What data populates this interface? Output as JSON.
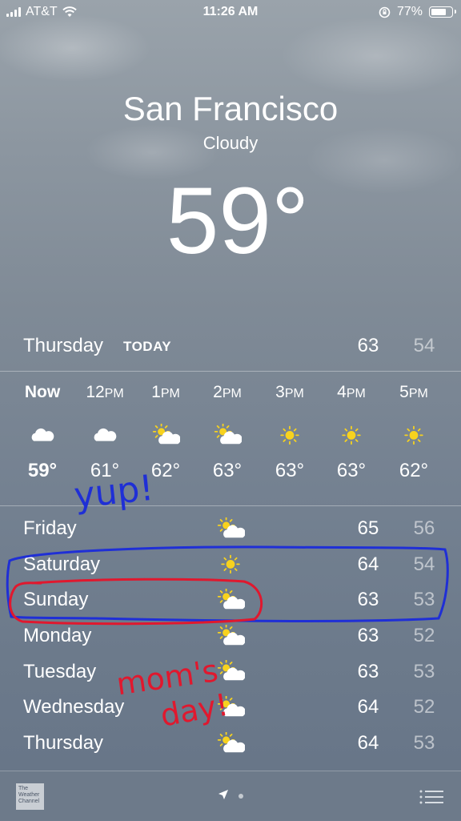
{
  "status_bar": {
    "carrier": "AT&T",
    "time": "11:26 AM",
    "battery": "77%",
    "battery_level": 0.77
  },
  "location": {
    "city": "San Francisco",
    "condition": "Cloudy",
    "temperature": "59°"
  },
  "today": {
    "day": "Thursday",
    "tag": "TODAY",
    "high": "63",
    "low": "54"
  },
  "hourly": [
    {
      "label": "Now",
      "suffix": "",
      "icon": "cloud-icon",
      "temp": "59°"
    },
    {
      "label": "12",
      "suffix": "PM",
      "icon": "cloud-icon",
      "temp": "61°"
    },
    {
      "label": "1",
      "suffix": "PM",
      "icon": "partly-sunny-icon",
      "temp": "62°"
    },
    {
      "label": "2",
      "suffix": "PM",
      "icon": "partly-sunny-icon",
      "temp": "63°"
    },
    {
      "label": "3",
      "suffix": "PM",
      "icon": "sun-icon",
      "temp": "63°"
    },
    {
      "label": "4",
      "suffix": "PM",
      "icon": "sun-icon",
      "temp": "63°"
    },
    {
      "label": "5",
      "suffix": "PM",
      "icon": "sun-icon",
      "temp": "62°"
    }
  ],
  "daily": [
    {
      "day": "Friday",
      "icon": "partly-sunny-icon",
      "high": "65",
      "low": "56"
    },
    {
      "day": "Saturday",
      "icon": "sun-icon",
      "high": "64",
      "low": "54"
    },
    {
      "day": "Sunday",
      "icon": "partly-sunny-icon",
      "high": "63",
      "low": "53"
    },
    {
      "day": "Monday",
      "icon": "partly-sunny-icon",
      "high": "63",
      "low": "52"
    },
    {
      "day": "Tuesday",
      "icon": "partly-sunny-icon",
      "high": "63",
      "low": "53"
    },
    {
      "day": "Wednesday",
      "icon": "partly-sunny-icon",
      "high": "64",
      "low": "52"
    },
    {
      "day": "Thursday",
      "icon": "partly-sunny-icon",
      "high": "64",
      "low": "53"
    }
  ],
  "bottom_bar": {
    "logo_text": "The Weather Channel"
  },
  "annotations": {
    "blue_note": "yup!",
    "red_note_line1": "mom's",
    "red_note_line2": "day!",
    "blue_color": "#1f2fd6",
    "red_color": "#e0182e"
  }
}
